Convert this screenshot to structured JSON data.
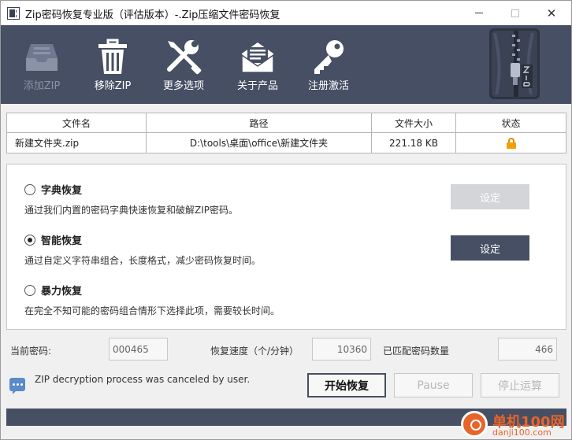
{
  "window": {
    "title": "Zip密码恢复专业版（评估版本）-.Zip压缩文件密码恢复",
    "minimize_glyph": "",
    "close_glyph": "✕"
  },
  "toolbar": {
    "add_zip": "添加ZIP",
    "remove_zip": "移除ZIP",
    "more_options": "更多选项",
    "about": "关于产品",
    "register": "注册激活"
  },
  "file_table": {
    "headers": [
      "文件名",
      "路径",
      "文件大小",
      "状态"
    ],
    "rows": [
      {
        "name": "新建文件夹.zip",
        "path": "D:\\tools\\桌面\\office\\新建文件夹",
        "size": "221.18 KB",
        "status_icon": "lock-icon"
      }
    ]
  },
  "recovery": {
    "options": [
      {
        "label": "字典恢复",
        "desc": "通过我们内置的密码字典快速恢复和破解ZIP密码。",
        "checked": false
      },
      {
        "label": "智能恢复",
        "desc": "通过自定义字符串组合，长度格式，减少密码恢复时间。",
        "checked": true
      },
      {
        "label": "暴力恢复",
        "desc": "在完全不知可能的密码组合情形下选择此项，需要较长时间。",
        "checked": false
      }
    ],
    "set_label": "设定"
  },
  "stats": {
    "current_password_label": "当前密码:",
    "current_password": "000465",
    "speed_label": "恢复速度（个/分钟）",
    "speed": "10360",
    "matched_label": "已匹配密码数量",
    "matched": "466"
  },
  "status": {
    "message": "ZIP decryption process was canceled by user."
  },
  "actions": {
    "start": "开始恢复",
    "pause": "Pause",
    "stop": "停止运算"
  },
  "watermark": {
    "cn": "单机100网",
    "en": "danji100.com"
  },
  "colors": {
    "toolbar_bg": "#464f63",
    "lock": "#f0a000",
    "watermark": "#e8642a"
  }
}
